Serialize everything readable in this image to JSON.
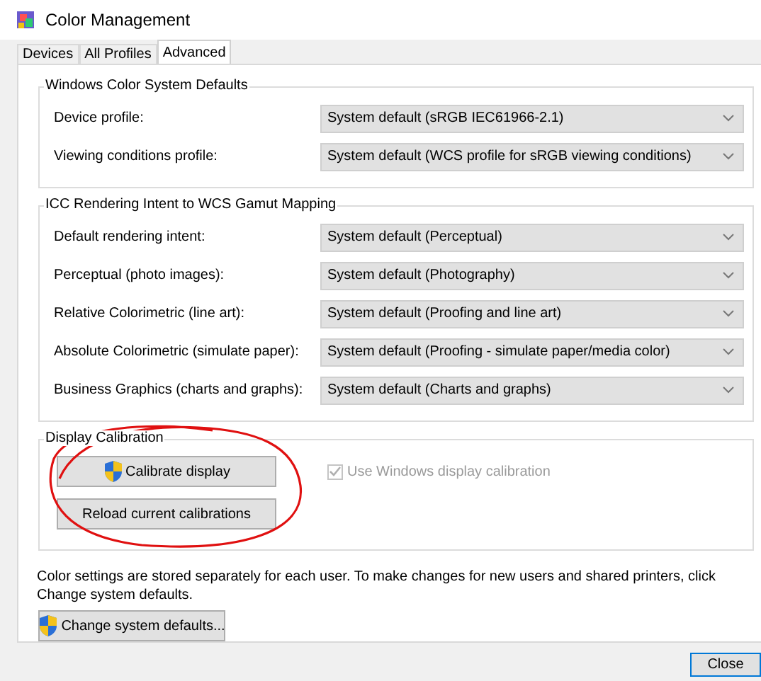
{
  "window": {
    "title": "Color Management"
  },
  "tabs": [
    {
      "label": "Devices",
      "selected": false
    },
    {
      "label": "All Profiles",
      "selected": false
    },
    {
      "label": "Advanced",
      "selected": true
    }
  ],
  "groups": [
    {
      "title": "Windows Color System Defaults",
      "rows": [
        {
          "label": "Device profile:",
          "value": "System default (sRGB IEC61966-2.1)"
        },
        {
          "label": "Viewing conditions profile:",
          "value": "System default (WCS profile for sRGB viewing conditions)"
        }
      ]
    },
    {
      "title": "ICC Rendering Intent to WCS Gamut Mapping",
      "rows": [
        {
          "label": "Default rendering intent:",
          "value": "System default (Perceptual)"
        },
        {
          "label": "Perceptual (photo images):",
          "value": "System default (Photography)"
        },
        {
          "label": "Relative Colorimetric (line art):",
          "value": "System default (Proofing and line art)"
        },
        {
          "label": "Absolute Colorimetric (simulate paper):",
          "value": "System default (Proofing - simulate paper/media color)"
        },
        {
          "label": "Business Graphics (charts and graphs):",
          "value": "System default (Charts and graphs)"
        }
      ]
    }
  ],
  "calibration": {
    "title": "Display Calibration",
    "buttons": [
      {
        "label": "Calibrate display",
        "shield": true
      },
      {
        "label": "Reload current calibrations",
        "shield": false
      }
    ],
    "checkbox": {
      "label": "Use Windows display calibration",
      "checked": true,
      "disabled": true
    }
  },
  "note": "Color settings are stored separately for each user. To make changes for new users and shared printers, click Change system defaults.",
  "change_button": {
    "label": "Change system defaults...",
    "shield": true
  },
  "close_button": {
    "label": "Close"
  }
}
